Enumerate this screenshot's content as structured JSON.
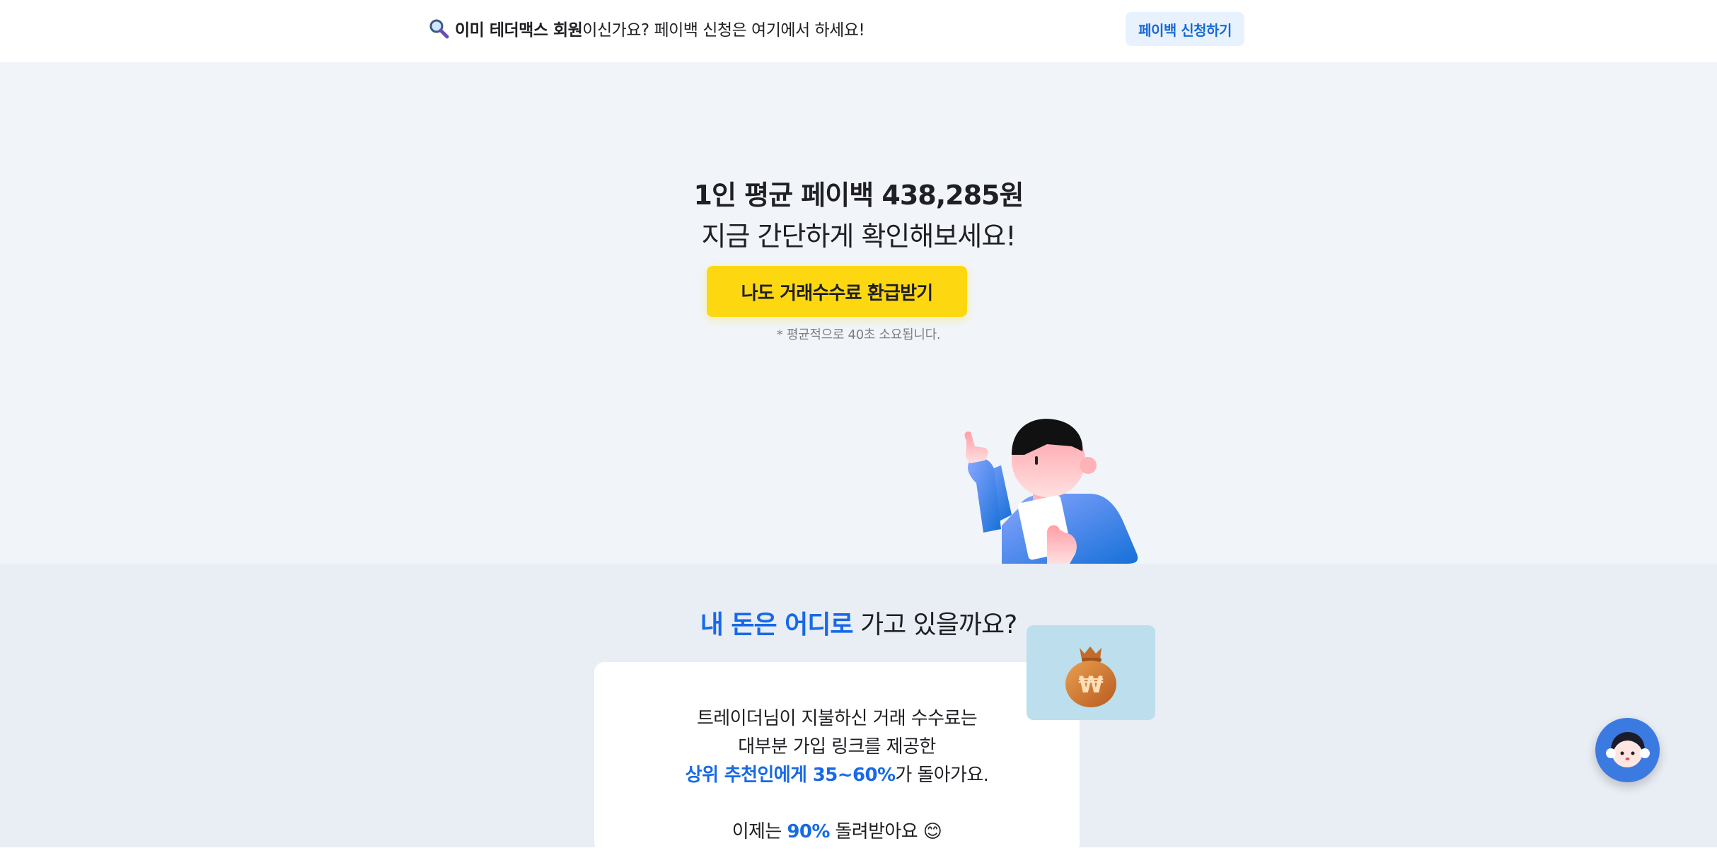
{
  "topbar": {
    "notice_bold": "이미 테더맥스 회원",
    "notice_rest": "이신가요? 페이백 신청은 여기에서 하세요!",
    "apply_button": "페이백 신청하기"
  },
  "hero": {
    "headline": "1인 평균 페이백 438,285원",
    "subheadline": "지금 간단하게 확인해보세요!",
    "cta_button": "나도 거래수수료 환급받기",
    "note": "* 평균적으로 40초 소요됩니다."
  },
  "section2": {
    "title_highlight": "내 돈은 어디로",
    "title_rest": " 가고 있을까요?",
    "card": {
      "line1": "트레이더님이 지불하신 거래 수수료는",
      "line2": "대부분 가입 링크를 제공한",
      "line3_highlight": "상위 추천인에게 35~60%",
      "line3_rest": "가 돌아가요.",
      "line4_prefix": "이제는 ",
      "line4_highlight": "90%",
      "line4_rest": " 돌려받아요 ",
      "line4_emoji": "😊"
    },
    "bag_symbol": "₩"
  },
  "colors": {
    "accent_blue": "#1769e8",
    "cta_yellow": "#fdd811",
    "hero_bg": "#f1f5f9",
    "section_bg": "#e9edf4"
  },
  "icons": {
    "notice_icon": "magnifier-icon",
    "bag_icon": "money-bag-icon",
    "chat_icon": "support-avatar-icon"
  }
}
